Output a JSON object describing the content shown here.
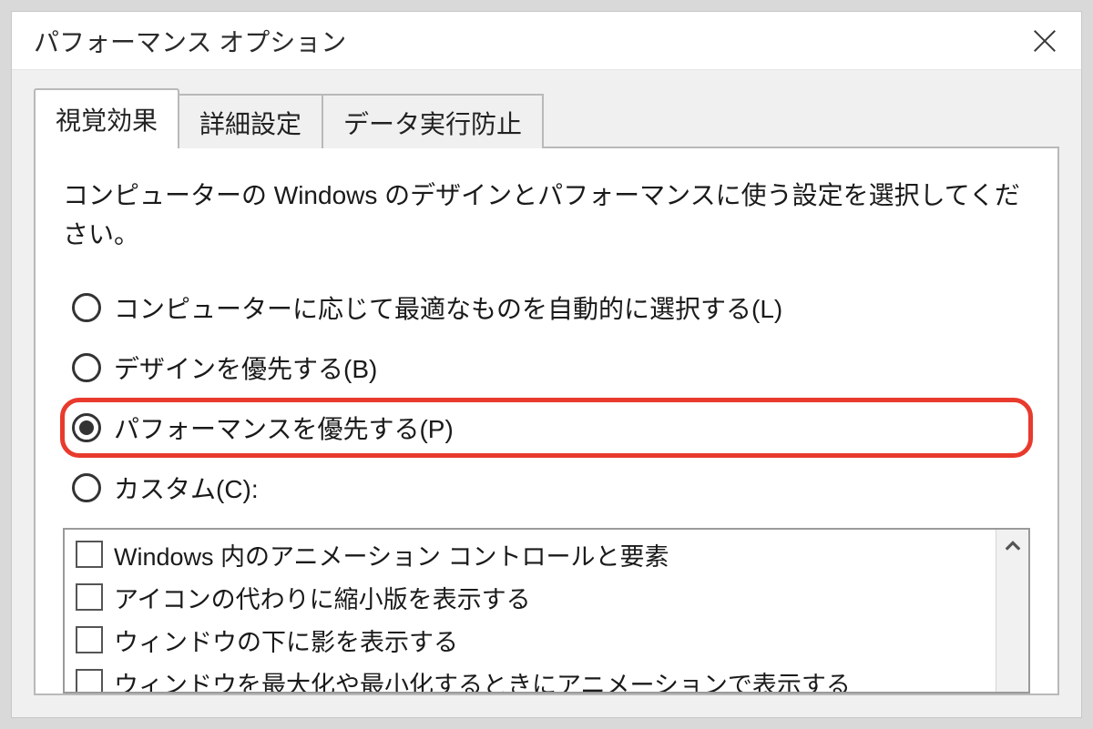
{
  "window": {
    "title": "パフォーマンス オプション"
  },
  "tabs": [
    {
      "label": "視覚効果",
      "active": true
    },
    {
      "label": "詳細設定",
      "active": false
    },
    {
      "label": "データ実行防止",
      "active": false
    }
  ],
  "panel": {
    "instruction": "コンピューターの Windows のデザインとパフォーマンスに使う設定を選択してください。",
    "radios": [
      {
        "label": "コンピューターに応じて最適なものを自動的に選択する(L)",
        "selected": false,
        "highlight": false
      },
      {
        "label": "デザインを優先する(B)",
        "selected": false,
        "highlight": false
      },
      {
        "label": "パフォーマンスを優先する(P)",
        "selected": true,
        "highlight": true
      },
      {
        "label": "カスタム(C):",
        "selected": false,
        "highlight": false
      }
    ],
    "checklist": [
      {
        "label": "Windows 内のアニメーション コントロールと要素",
        "checked": false
      },
      {
        "label": "アイコンの代わりに縮小版を表示する",
        "checked": false
      },
      {
        "label": "ウィンドウの下に影を表示する",
        "checked": false
      },
      {
        "label": "ウィンドウを最大化や最小化するときにアニメーションで表示する",
        "checked": false
      }
    ]
  }
}
